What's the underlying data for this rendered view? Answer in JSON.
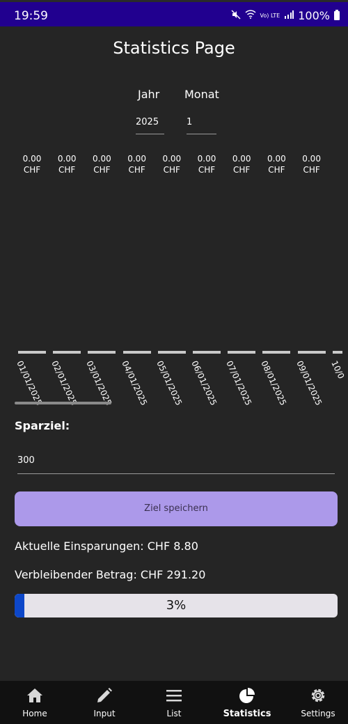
{
  "status_bar": {
    "time": "19:59",
    "network": "Vo) LTE",
    "battery": "100%"
  },
  "page_title": "Statistics Page",
  "filters": {
    "year_label": "Jahr",
    "year_value": "2025",
    "month_label": "Monat",
    "month_value": "1"
  },
  "chart_data": {
    "type": "bar",
    "categories": [
      "01/01/2025",
      "02/01/2025",
      "03/01/2025",
      "04/01/2025",
      "05/01/2025",
      "06/01/2025",
      "07/01/2025",
      "08/01/2025",
      "09/01/2025",
      "10/0"
    ],
    "values": [
      0,
      0,
      0,
      0,
      0,
      0,
      0,
      0,
      0
    ],
    "value_labels": [
      "0.00",
      "0.00",
      "0.00",
      "0.00",
      "0.00",
      "0.00",
      "0.00",
      "0.00",
      "0.00"
    ],
    "unit": "CHF"
  },
  "savings_goal": {
    "label": "Sparziel:",
    "input_value": "300",
    "save_label": "Ziel speichern",
    "current_text": "Aktuelle Einsparungen: CHF 8.80",
    "remaining_text": "Verbleibender Betrag: CHF 291.20",
    "progress_percent": 3,
    "progress_text": "3%"
  },
  "nav": {
    "items": [
      {
        "label": "Home",
        "icon": "home-icon"
      },
      {
        "label": "Input",
        "icon": "pencil-icon"
      },
      {
        "label": "List",
        "icon": "menu-icon"
      },
      {
        "label": "Statistics",
        "icon": "pie-chart-icon"
      },
      {
        "label": "Settings",
        "icon": "gear-icon"
      }
    ],
    "active": "Statistics"
  }
}
